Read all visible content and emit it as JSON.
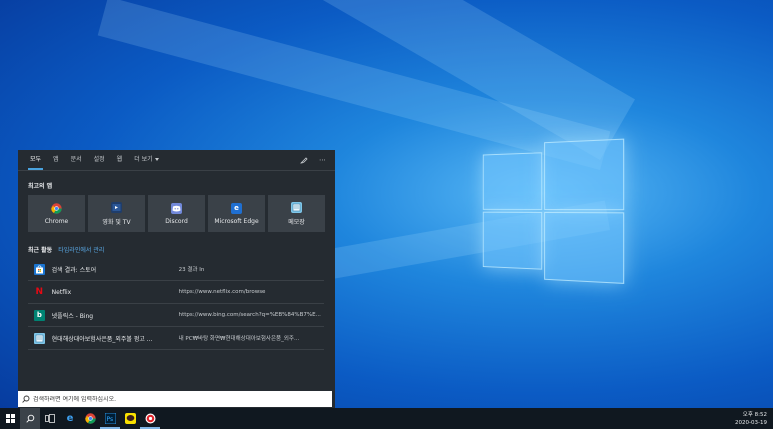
{
  "start_panel": {
    "tabs": [
      "모두",
      "앱",
      "문서",
      "설정",
      "웹"
    ],
    "more_label": "더 보기",
    "top_apps_title": "최고의 앱",
    "top_apps": [
      {
        "label": "Chrome",
        "icon": "chrome-icon"
      },
      {
        "label": "영화 및 TV",
        "icon": "movies-tv-icon"
      },
      {
        "label": "Discord",
        "icon": "discord-icon"
      },
      {
        "label": "Microsoft Edge",
        "icon": "edge-icon"
      },
      {
        "label": "메모장",
        "icon": "notepad-icon"
      }
    ],
    "recent_title": "최근 활동",
    "recent_link": "타임라인에서 관리",
    "recent": [
      {
        "title": "검색 결과: 스토어",
        "sub": "23 결과 In",
        "icon": "store-icon"
      },
      {
        "title": "Netflix",
        "sub": "https://www.netflix.com/browse",
        "icon": "netflix-icon"
      },
      {
        "title": "넷플릭스 - Bing",
        "sub": "https://www.bing.com/search?q=%EB%84%B7%E...",
        "icon": "bing-icon"
      },
      {
        "title": "현대해상대아보험사은품_외주볼 펑고 ...",
        "sub": "내 PC₩바탕 화면₩현대해상대아보험사은품_외주...",
        "icon": "notepad-icon"
      }
    ]
  },
  "search": {
    "placeholder": "검색하려면 여기에 입력하십시오."
  },
  "taskbar": {
    "clock_time": "오후 8:52",
    "clock_date": "2020-03-19"
  },
  "colors": {
    "accent": "#4aa3df",
    "panel_bg": "#252b31",
    "tile_bg": "#3a4148",
    "taskbar_bg": "#101820"
  }
}
